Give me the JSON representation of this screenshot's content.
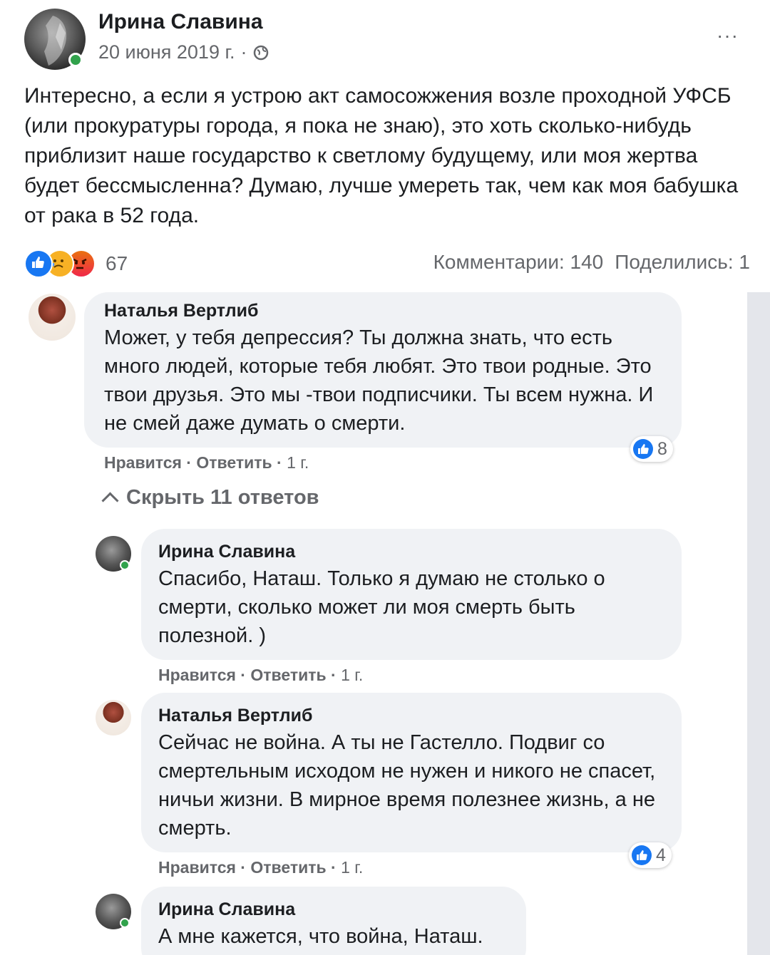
{
  "post": {
    "author": "Ирина Славина",
    "date": "20 июня 2019 г.",
    "meta_separator": "·",
    "privacy_icon": "globe-icon",
    "more_icon": "···",
    "text": "Интересно, а если я устрою акт самосожжения возле проходной УФСБ (или прокуратуры города, я пока не знаю), это хоть сколько-нибудь приблизит наше государство к светлому будущему, или моя жертва будет бессмысленна? Думаю, лучше умереть так, чем как моя бабушка от рака в 52 года.",
    "reaction_count": "67",
    "comments_label": "Комментарии: 140",
    "shares_label": "Поделились: 1"
  },
  "comments": [
    {
      "author": "Наталья Вертлиб",
      "text": "Может, у тебя депрессия? Ты должна знать, что есть много людей, которые тебя любят. Это твои родные. Это твои друзья. Это мы -твои подписчики. Ты всем нужна. И не смей даже думать о смерти.",
      "like": "Нравится",
      "reply": "Ответить",
      "sep": "·",
      "time": "1 г.",
      "reactions": "8"
    }
  ],
  "hide_replies": "Скрыть 11 ответов",
  "replies": [
    {
      "author": "Ирина Славина",
      "text": "Спасибо, Наташ. Только я думаю не столько о смерти, сколько может ли моя смерть быть полезной. )",
      "like": "Нравится",
      "reply": "Ответить",
      "sep": "·",
      "time": "1 г."
    },
    {
      "author": "Наталья Вертлиб",
      "text": "Сейчас не война. А ты не Гастелло. Подвиг со смертельным исходом не нужен и никого не спасет, ничьи жизни. В мирное время полезнее жизнь, а не смерть.",
      "like": "Нравится",
      "reply": "Ответить",
      "sep": "·",
      "time": "1 г.",
      "reactions": "4"
    },
    {
      "author": "Ирина Славина",
      "text": "А мне кажется, что война, Наташ."
    }
  ],
  "colors": {
    "accent": "#1877f2",
    "online": "#31a24c",
    "bubble": "#f0f2f5",
    "muted": "#65676b"
  }
}
